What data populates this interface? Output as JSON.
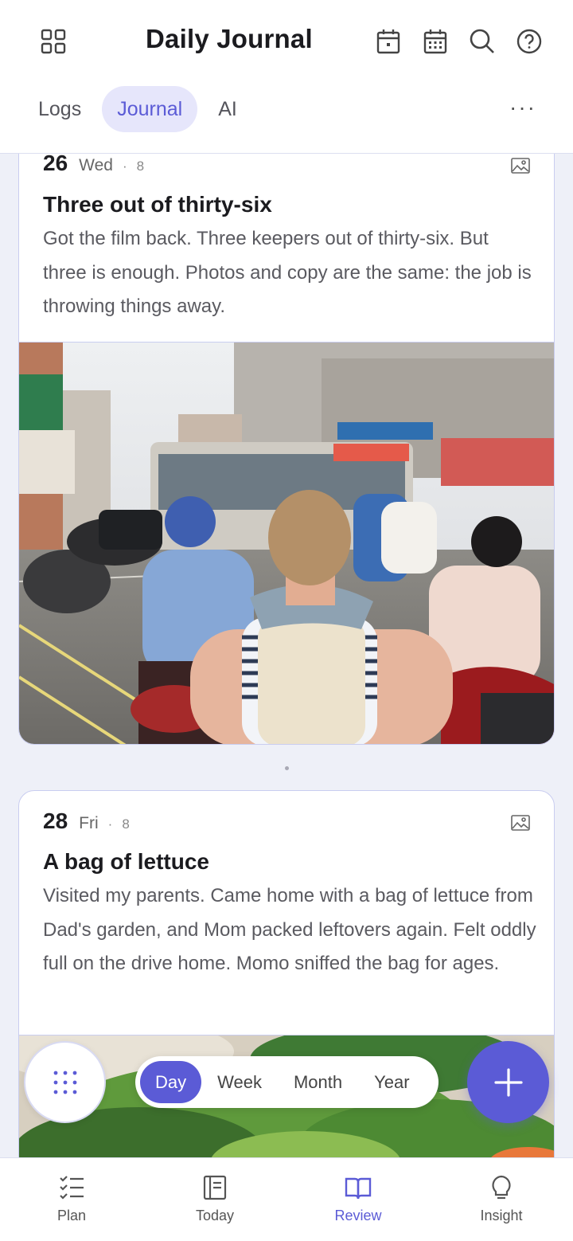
{
  "header": {
    "title": "Daily Journal",
    "icons": [
      "grid-icon",
      "calendar-day-icon",
      "calendar-month-icon",
      "search-icon",
      "help-icon"
    ]
  },
  "tabs": [
    {
      "label": "Logs",
      "active": false
    },
    {
      "label": "Journal",
      "active": true
    },
    {
      "label": "AI",
      "active": false
    }
  ],
  "more_label": "···",
  "entries": [
    {
      "day": "26",
      "weekday": "Wed",
      "separator": "·",
      "count": "8",
      "title": "Three out of thirty-six",
      "body": "Got the film back. Three keepers out of thirty-six. But three is enough. Photos and copy are the same: the job is throwing things away.",
      "photo": "street-scene-photo"
    },
    {
      "day": "28",
      "weekday": "Fri",
      "separator": "·",
      "count": "8",
      "title": "A bag of lettuce",
      "body": "Visited my parents. Came home with a bag of lettuce from Dad's garden, and Mom packed leftovers again. Felt oddly full on the drive home. Momo sniffed the bag for ages.",
      "photo": "lettuce-photo"
    }
  ],
  "period_selector": [
    {
      "label": "Day",
      "active": true
    },
    {
      "label": "Week",
      "active": false
    },
    {
      "label": "Month",
      "active": false
    },
    {
      "label": "Year",
      "active": false
    }
  ],
  "bottom_nav": [
    {
      "label": "Plan",
      "icon": "checklist-icon",
      "active": false
    },
    {
      "label": "Today",
      "icon": "document-icon",
      "active": false
    },
    {
      "label": "Review",
      "icon": "book-open-icon",
      "active": true
    },
    {
      "label": "Insight",
      "icon": "lightbulb-icon",
      "active": false
    }
  ],
  "colors": {
    "accent": "#5b5bd6",
    "accent_light": "#e6e6fb",
    "background": "#eef0f8",
    "card_border": "#c9cdf0"
  }
}
